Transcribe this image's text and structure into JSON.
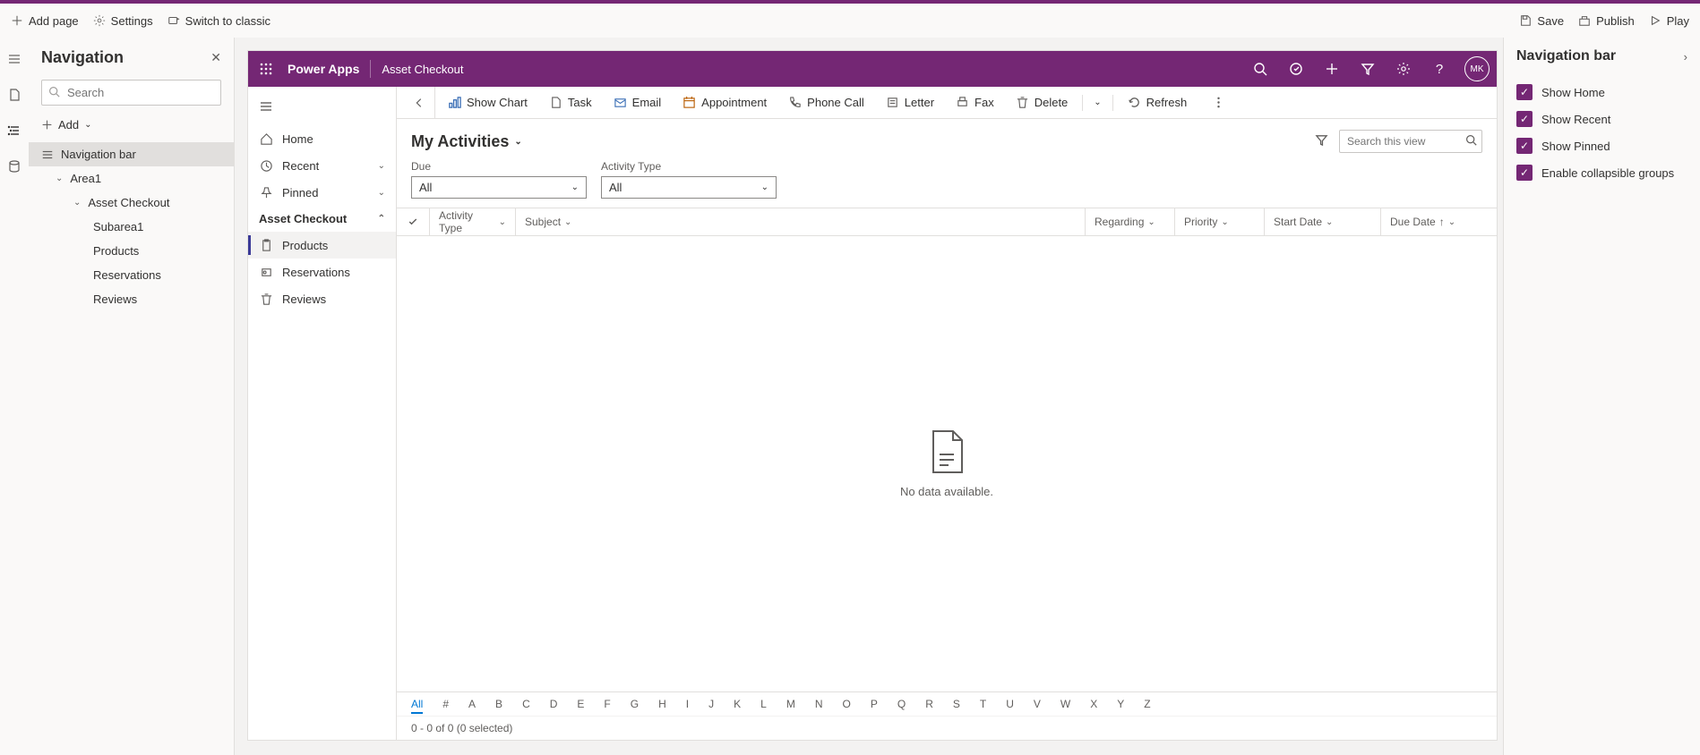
{
  "toolbar": {
    "add_page": "Add page",
    "settings": "Settings",
    "switch_classic": "Switch to classic",
    "save": "Save",
    "publish": "Publish",
    "play": "Play"
  },
  "nav_panel": {
    "title": "Navigation",
    "search_placeholder": "Search",
    "add": "Add",
    "tree": {
      "navigation_bar": "Navigation bar",
      "area1": "Area1",
      "asset_checkout": "Asset Checkout",
      "subarea1": "Subarea1",
      "products": "Products",
      "reservations": "Reservations",
      "reviews": "Reviews"
    }
  },
  "app": {
    "brand": "Power Apps",
    "subtitle": "Asset Checkout",
    "avatar": "MK"
  },
  "sitemap": {
    "home": "Home",
    "recent": "Recent",
    "pinned": "Pinned",
    "group": "Asset Checkout",
    "products": "Products",
    "reservations": "Reservations",
    "reviews": "Reviews"
  },
  "cmdbar": {
    "show_chart": "Show Chart",
    "task": "Task",
    "email": "Email",
    "appointment": "Appointment",
    "phone_call": "Phone Call",
    "letter": "Letter",
    "fax": "Fax",
    "delete": "Delete",
    "refresh": "Refresh"
  },
  "view": {
    "title": "My Activities",
    "search_placeholder": "Search this view",
    "due_label": "Due",
    "due_value": "All",
    "activity_type_label": "Activity Type",
    "activity_type_value": "All"
  },
  "columns": {
    "activity_type": "Activity Type",
    "subject": "Subject",
    "regarding": "Regarding",
    "priority": "Priority",
    "start_date": "Start Date",
    "due_date": "Due Date"
  },
  "empty_msg": "No data available.",
  "alpha": [
    "All",
    "#",
    "A",
    "B",
    "C",
    "D",
    "E",
    "F",
    "G",
    "H",
    "I",
    "J",
    "K",
    "L",
    "M",
    "N",
    "O",
    "P",
    "Q",
    "R",
    "S",
    "T",
    "U",
    "V",
    "W",
    "X",
    "Y",
    "Z"
  ],
  "status": "0 - 0 of 0 (0 selected)",
  "right_panel": {
    "title": "Navigation bar",
    "show_home": "Show Home",
    "show_recent": "Show Recent",
    "show_pinned": "Show Pinned",
    "enable_collapsible": "Enable collapsible groups"
  }
}
